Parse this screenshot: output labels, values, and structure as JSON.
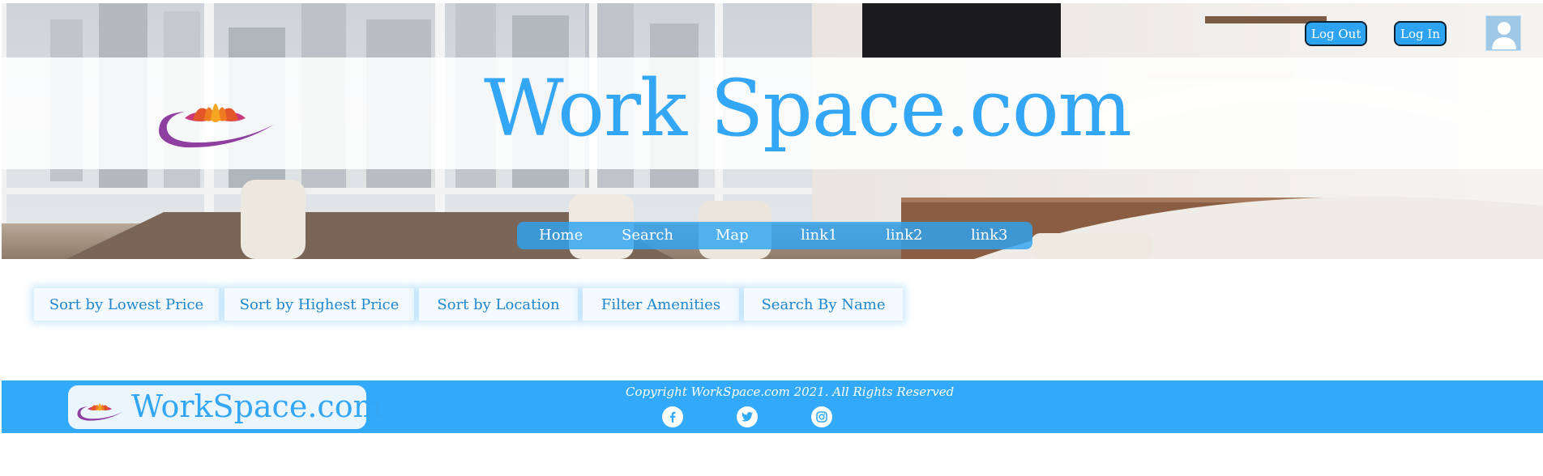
{
  "header": {
    "site_title": "Work Space.com",
    "logo_icon": "lotus-logo-icon",
    "auth": {
      "logout_label": "Log Out",
      "login_label": "Log In"
    },
    "avatar_icon": "user-avatar-icon"
  },
  "nav": {
    "items": [
      {
        "label": "Home"
      },
      {
        "label": "Search"
      },
      {
        "label": "Map"
      },
      {
        "label": "link1"
      },
      {
        "label": "link2"
      },
      {
        "label": "link3"
      }
    ]
  },
  "toolbar": {
    "buttons": [
      {
        "label": "Sort by Lowest Price"
      },
      {
        "label": "Sort by Highest Price"
      },
      {
        "label": "Sort by Location"
      },
      {
        "label": "Filter Amenities"
      },
      {
        "label": "Search By Name"
      }
    ]
  },
  "footer": {
    "brand": "WorkSpace.com",
    "copyright": "Copyright WorkSpace.com 2021. All Rights Reserved",
    "social_icons": [
      "facebook-icon",
      "twitter-icon",
      "instagram-icon"
    ]
  },
  "colors": {
    "accent": "#33a6f5",
    "footer_bg": "#33a9fb",
    "nav_bg": "#2ea3f2"
  }
}
